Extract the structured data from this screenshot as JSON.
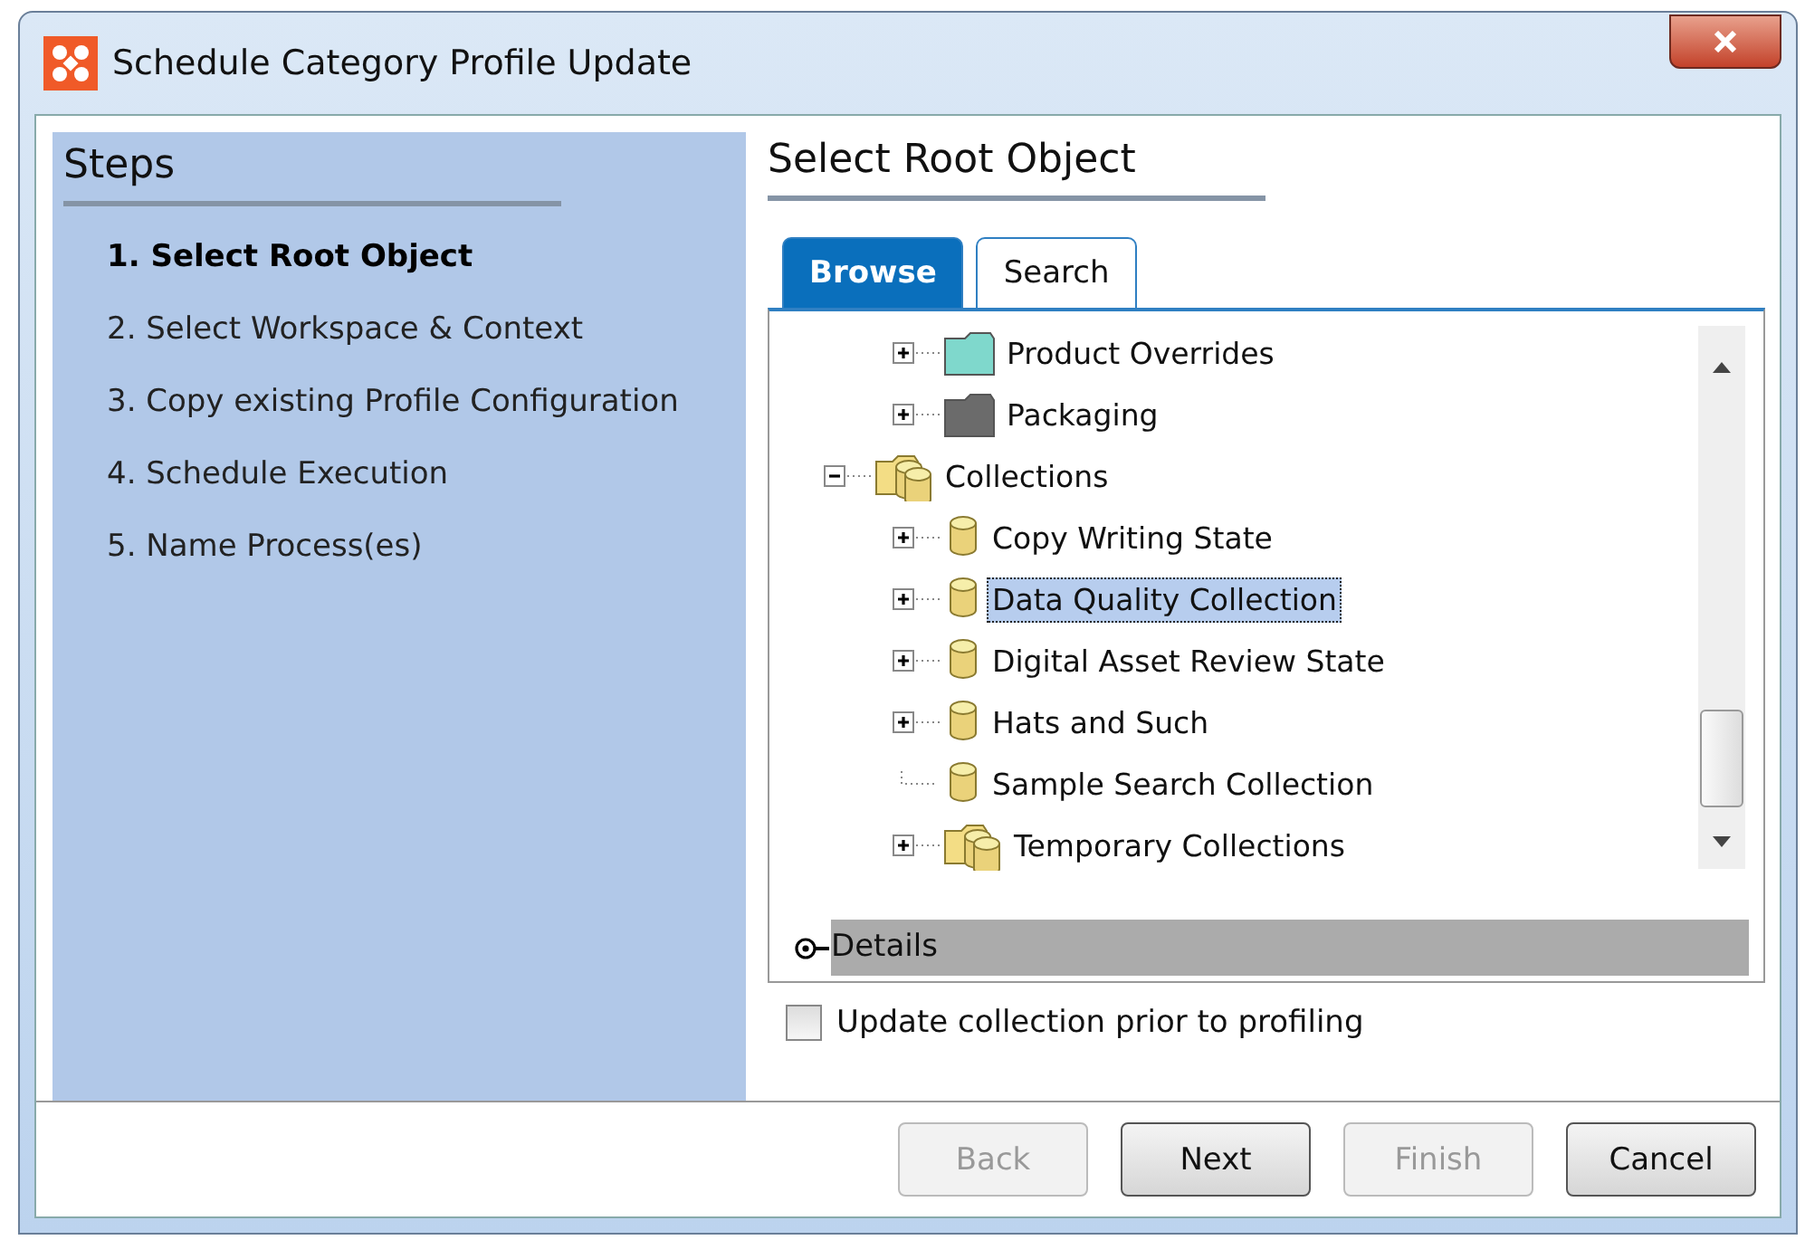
{
  "window": {
    "title": "Schedule Category Profile Update"
  },
  "steps": {
    "title": "Steps",
    "items": [
      {
        "label": "1. Select Root Object",
        "selected": true
      },
      {
        "label": "2. Select Workspace & Context",
        "selected": false
      },
      {
        "label": "3. Copy existing Profile Configuration",
        "selected": false
      },
      {
        "label": "4. Schedule Execution",
        "selected": false
      },
      {
        "label": "5. Name Process(es)",
        "selected": false
      }
    ]
  },
  "page_title": "Select Root Object",
  "tabs": [
    {
      "label": "Browse",
      "selected": true
    },
    {
      "label": "Search",
      "selected": false
    }
  ],
  "tree": {
    "partial_branch": [
      {
        "label": "Product Overrides",
        "kind": "folder",
        "color": "#7fd8cc",
        "expanded": false,
        "selected": false
      },
      {
        "label": "Packaging",
        "kind": "folder",
        "color": "#6b6b6b",
        "expanded": false,
        "selected": false
      }
    ],
    "nodes": [
      {
        "label": "Collections",
        "kind": "group",
        "expanded": true,
        "selected": false,
        "children": [
          {
            "label": "Copy Writing State",
            "kind": "collection",
            "expanded": false,
            "selected": false
          },
          {
            "label": "Data Quality Collection",
            "kind": "collection",
            "expanded": false,
            "selected": true
          },
          {
            "label": "Digital Asset Review State",
            "kind": "collection",
            "expanded": false,
            "selected": false
          },
          {
            "label": "Hats and Such",
            "kind": "collection",
            "expanded": false,
            "selected": false
          },
          {
            "label": "Sample Search Collection",
            "kind": "collection",
            "selected": false
          },
          {
            "label": "Temporary Collections",
            "kind": "group",
            "expanded": false,
            "selected": false
          }
        ]
      }
    ]
  },
  "details": {
    "label": "Details",
    "expanded": false
  },
  "update_checkbox": {
    "label": "Update collection prior to profiling",
    "checked": false
  },
  "buttons": [
    {
      "label": "Back",
      "disabled": true
    },
    {
      "label": "Next",
      "disabled": false
    },
    {
      "label": "Finish",
      "disabled": true
    },
    {
      "label": "Cancel",
      "disabled": false
    }
  ]
}
